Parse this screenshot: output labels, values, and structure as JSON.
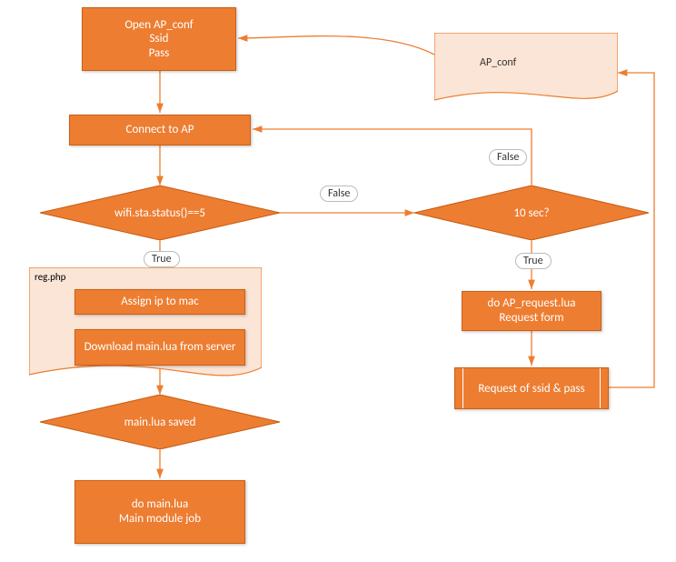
{
  "nodes": {
    "open_ap_conf": "Open AP_conf\nSsid\nPass",
    "connect_ap": "Connect to AP",
    "wifi_status": "wifi.sta.status()==5",
    "reg_php": "reg.php",
    "assign_ip": "Assign ip to mac",
    "download_main": "Download main.lua from server",
    "main_saved": "main.lua saved",
    "do_main": "do main.lua\nMain module job",
    "ten_sec": "10 sec?",
    "do_ap_request": "do AP_request.lua\nRequest form",
    "request_ssid": "Request of ssid & pass",
    "ap_conf_doc": "AP_conf"
  },
  "labels": {
    "true1": "True",
    "true2": "True",
    "false1": "False",
    "false2": "False"
  },
  "colors": {
    "fill": "#ED7D31",
    "stroke": "#C65A11",
    "arrow": "#ED7D31",
    "docFill": "#FBE5D6",
    "docStroke": "#ED7D31"
  }
}
